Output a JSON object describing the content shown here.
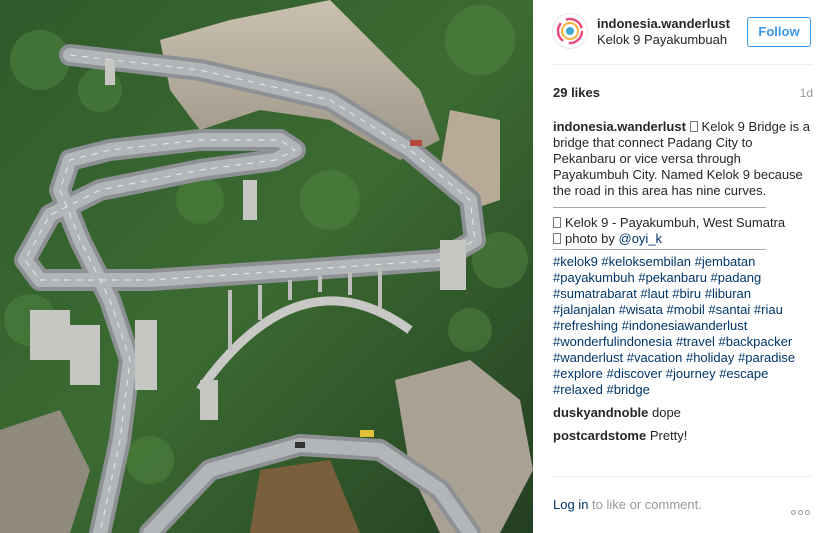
{
  "post": {
    "username": "indonesia.wanderlust",
    "location": "Kelok 9 Payakumbuah",
    "follow_label": "Follow",
    "likes": "29 likes",
    "age": "1d"
  },
  "caption": {
    "author": "indonesia.wanderlust",
    "lines": [
      "Kelok 9 Bridge is a",
      "bridge that connect Padang City to",
      "Pekanbaru or vice versa through",
      "Payakumbuh City. Named Kelok 9 because",
      "the road in this area has nine curves."
    ],
    "place_line": "Kelok 9 - Payakumbuh, West Sumatra",
    "photo_by_prefix": "photo by ",
    "photo_by_handle": "@oyi_k",
    "hashtag_lines": [
      "#kelok9 #keloksembilan #jembatan",
      "#payakumbuh #pekanbaru #padang",
      "#sumatrabarat #laut #biru #liburan",
      "#jalanjalan #wisata #mobil #santai #riau",
      "#refreshing #indonesiawanderlust",
      "#wonderfulindonesia #travel #backpacker",
      "#wanderlust #vacation #holiday #paradise",
      "#explore #discover #journey #escape",
      "#relaxed #bridge"
    ]
  },
  "comments": [
    {
      "author": "duskyandnoble",
      "text": "dope"
    },
    {
      "author": "postcardstome",
      "text": "Pretty!"
    }
  ],
  "footer": {
    "login_label": "Log in",
    "rest_text": " to like or comment."
  },
  "icons": {
    "avatar": "logo-icon",
    "more": "more-options-icon"
  },
  "colors": {
    "accent": "#3897f0",
    "link": "#003569",
    "muted": "#999999"
  }
}
